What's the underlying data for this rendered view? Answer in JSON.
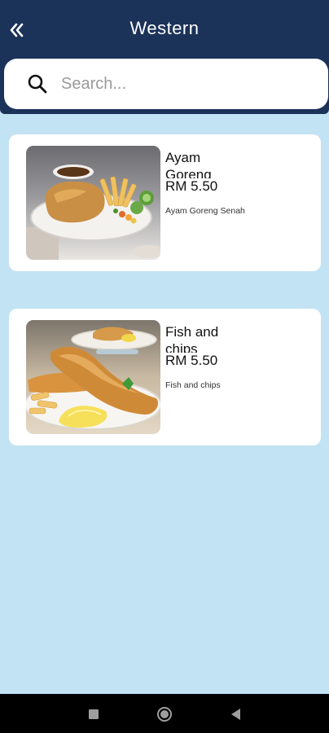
{
  "header": {
    "title": "Western",
    "back_icon": "double-chevron-left-icon"
  },
  "search": {
    "placeholder": "Search...",
    "icon": "search-icon"
  },
  "items": [
    {
      "name": "Ayam Goreng Senah",
      "price": "RM 5.50",
      "description": "Ayam Goreng Senah",
      "image": "fried chicken with fries and salad"
    },
    {
      "name": "Fish and chips",
      "price": "RM 5.50",
      "description": "Fish and chips",
      "image": "battered fish fillets with fries and lemon"
    }
  ],
  "navbar": {
    "buttons": [
      "recent-apps-icon",
      "home-icon",
      "back-icon"
    ]
  },
  "colors": {
    "header": "#1b3259",
    "background": "#c2e3f3",
    "card": "#ffffff",
    "navbar": "#000000"
  }
}
